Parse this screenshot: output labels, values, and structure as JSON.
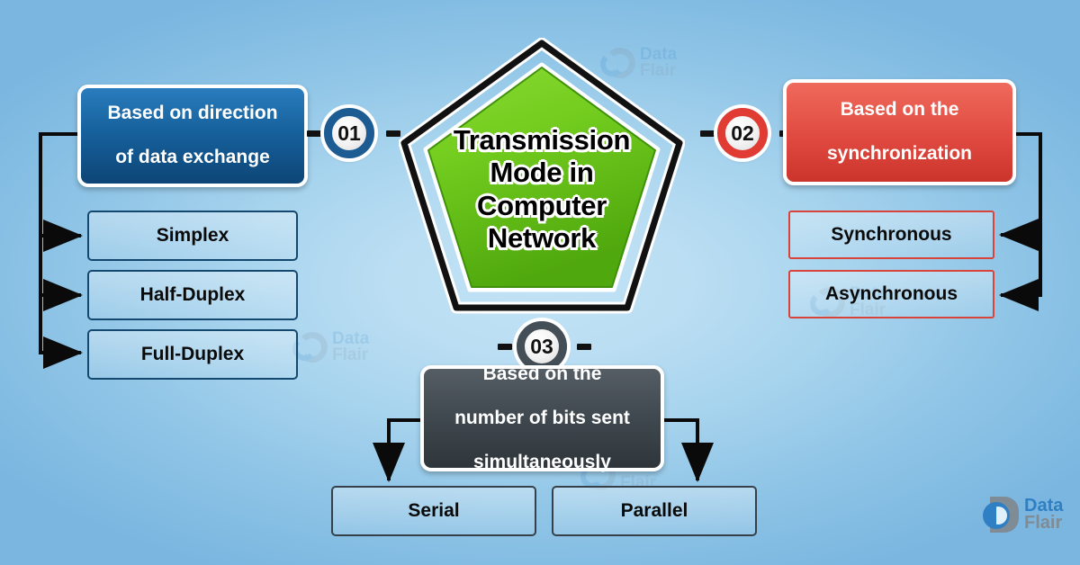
{
  "background": {
    "edge_color": "#7ab6e0",
    "center_color": "#c2e2f5"
  },
  "center": {
    "title_lines": [
      "Transmission",
      "Mode in",
      "Computer",
      "Network"
    ],
    "shape": "pentagon",
    "fill_color": "#6ec81e",
    "outline_color": "#111111"
  },
  "branches": [
    {
      "badge": "01",
      "accent_color": "#1d5c93",
      "heading_lines": [
        "Based on direction",
        "of data exchange"
      ],
      "items": [
        "Simplex",
        "Half-Duplex",
        "Full-Duplex"
      ]
    },
    {
      "badge": "02",
      "accent_color": "#e03c34",
      "heading_lines": [
        "Based on the",
        "synchronization"
      ],
      "items": [
        "Synchronous",
        "Asynchronous"
      ]
    },
    {
      "badge": "03",
      "accent_color": "#434e56",
      "heading_lines": [
        "Based on the",
        "number of bits sent",
        "simultaneously"
      ],
      "items": [
        "Serial",
        "Parallel"
      ]
    }
  ],
  "logo": {
    "name_part1": "Data",
    "name_part2": "Flair",
    "color1": "#2f7fc4",
    "color2": "#7f8c95"
  },
  "watermark": {
    "name_part1": "Data",
    "name_part2": "Flair"
  }
}
